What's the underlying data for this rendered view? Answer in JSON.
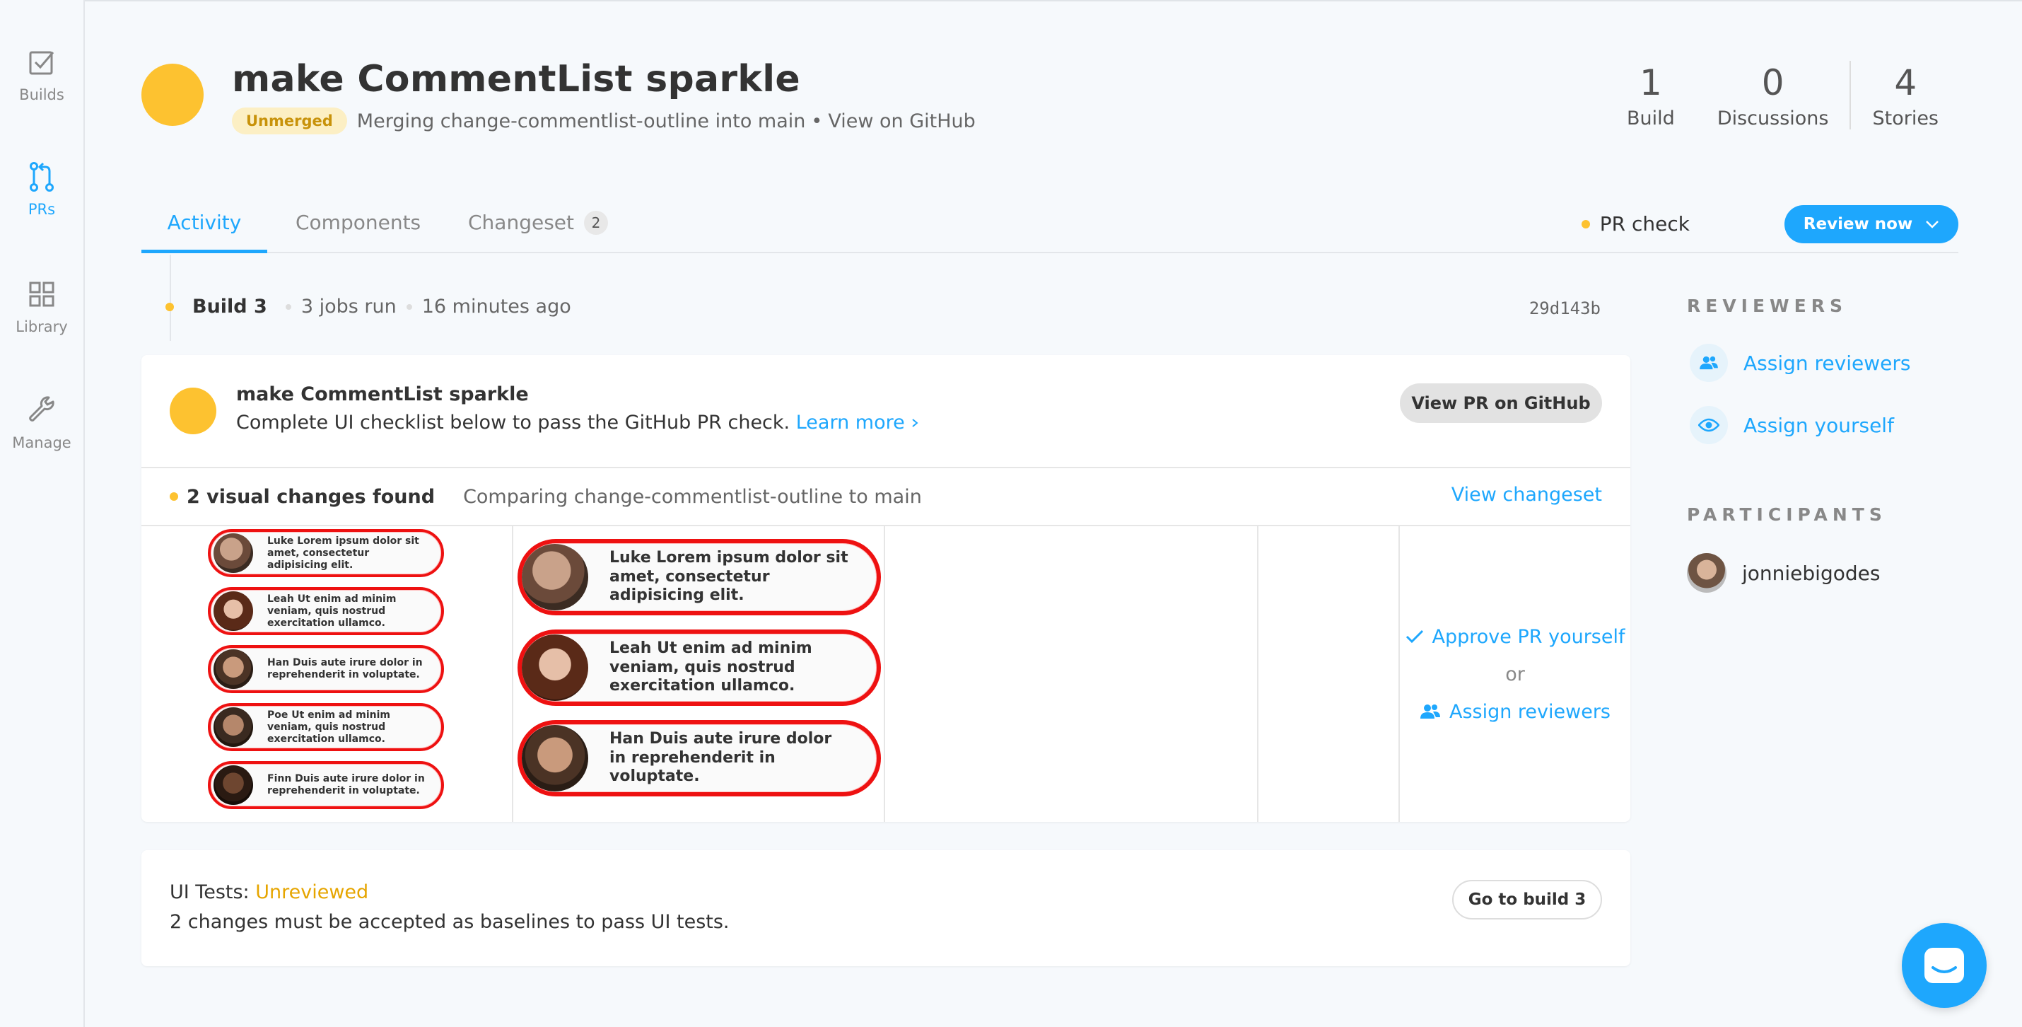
{
  "sidebar": {
    "items": [
      {
        "label": "Builds",
        "icon": "checkbox-icon"
      },
      {
        "label": "PRs",
        "icon": "pull-request-icon"
      },
      {
        "label": "Library",
        "icon": "grid-icon"
      },
      {
        "label": "Manage",
        "icon": "wrench-icon"
      }
    ]
  },
  "header": {
    "title": "make CommentList sparkle",
    "badge": "Unmerged",
    "merge_text": "Merging change-commentlist-outline into main",
    "bullet": "•",
    "github_link": "View on GitHub",
    "stats": [
      {
        "num": "1",
        "label": "Build"
      },
      {
        "num": "0",
        "label": "Discussions"
      },
      {
        "num": "4",
        "label": "Stories"
      }
    ]
  },
  "tabs": {
    "activity": "Activity",
    "components": "Components",
    "changeset": "Changeset",
    "changeset_count": "2",
    "pr_check": "PR check",
    "review_now": "Review now"
  },
  "build": {
    "name": "Build 3",
    "jobs": "3 jobs run",
    "time": "16 minutes ago",
    "commit": "29d143b"
  },
  "card": {
    "title": "make CommentList sparkle",
    "desc": "Complete UI checklist below to pass the GitHub PR check.",
    "learn_more": "Learn more",
    "gh_button": "View PR on GitHub",
    "changes_found": "2 visual changes found",
    "comparing": "Comparing change-commentlist-outline to main",
    "view_changeset": "View changeset",
    "snap1": [
      "Luke Lorem ipsum dolor sit amet, consectetur adipisicing elit.",
      "Leah Ut enim ad minim veniam, quis nostrud exercitation ullamco.",
      "Han Duis aute irure dolor in reprehenderit in voluptate.",
      "Poe Ut enim ad minim veniam, quis nostrud exercitation ullamco.",
      "Finn Duis aute irure dolor in reprehenderit in voluptate."
    ],
    "snap2": [
      "Luke Lorem ipsum dolor sit amet, consectetur adipisicing elit.",
      "Leah Ut enim ad minim veniam, quis nostrud exercitation ullamco.",
      "Han Duis aute irure dolor in reprehenderit in voluptate."
    ],
    "approve": "Approve PR yourself",
    "or": "or",
    "assign": "Assign reviewers"
  },
  "ui_tests": {
    "label": "UI Tests:",
    "status": "Unreviewed",
    "desc": "2 changes must be accepted as baselines to pass UI tests.",
    "button": "Go to build 3"
  },
  "right_panel": {
    "reviewers_title": "REVIEWERS",
    "assign_reviewers": "Assign reviewers",
    "assign_yourself": "Assign yourself",
    "participants_title": "PARTICIPANTS",
    "participant": "jonniebigodes"
  },
  "colors": {
    "accent": "#1ea7fd",
    "pending": "#fdc230",
    "diff": "#ee1111"
  }
}
